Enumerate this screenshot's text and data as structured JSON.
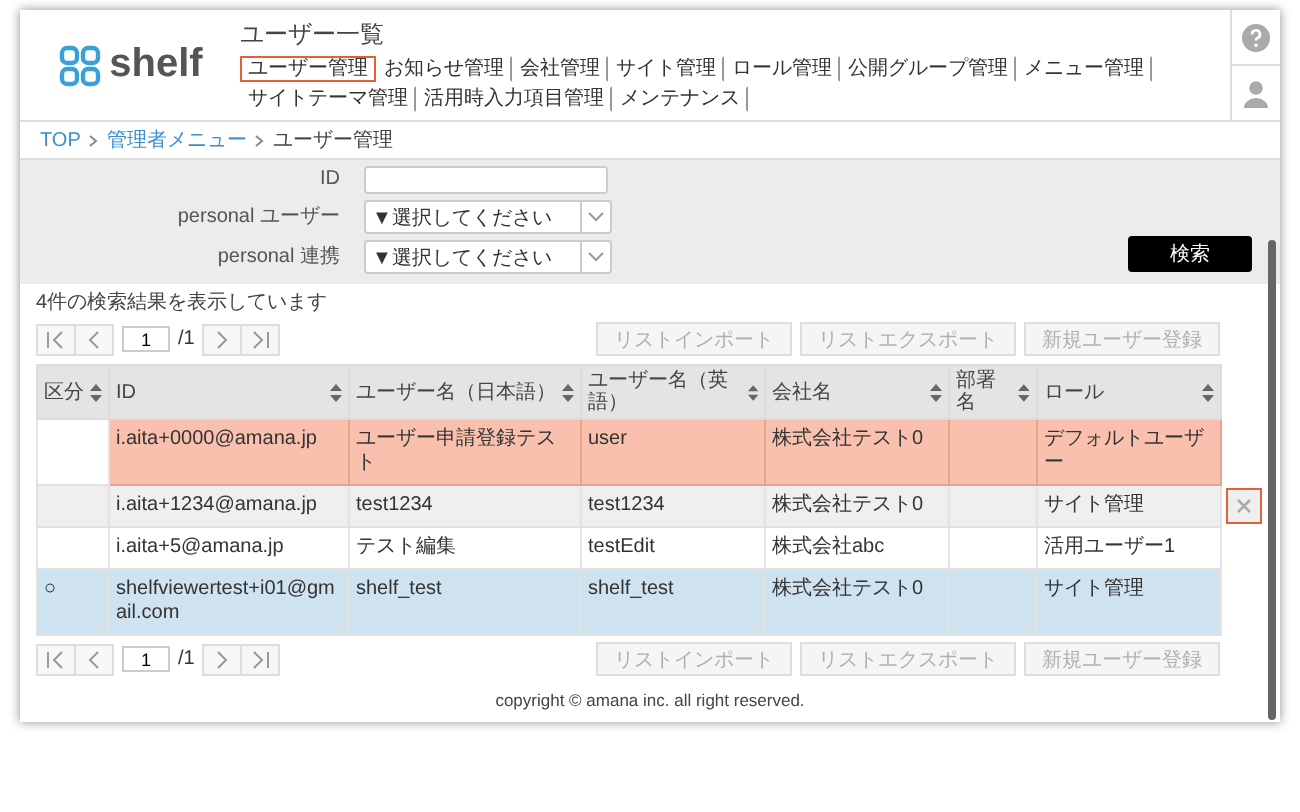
{
  "header": {
    "logo_text": "shelf",
    "title": "ユーザー一覧",
    "nav": [
      {
        "label": "ユーザー管理",
        "selected": true
      },
      {
        "label": "お知らせ管理",
        "selected": false
      },
      {
        "label": "会社管理",
        "selected": false
      },
      {
        "label": "サイト管理",
        "selected": false
      },
      {
        "label": "ロール管理",
        "selected": false
      },
      {
        "label": "公開グループ管理",
        "selected": false
      },
      {
        "label": "メニュー管理",
        "selected": false
      },
      {
        "label": "サイトテーマ管理",
        "selected": false
      },
      {
        "label": "活用時入力項目管理",
        "selected": false
      },
      {
        "label": "メンテナンス",
        "selected": false
      }
    ]
  },
  "breadcrumb": [
    {
      "label": "TOP",
      "link": true
    },
    {
      "label": "管理者メニュー",
      "link": true
    },
    {
      "label": "ユーザー管理",
      "link": false
    }
  ],
  "search": {
    "fields": [
      {
        "label": "ID",
        "kind": "text"
      },
      {
        "label": "personal ユーザー",
        "kind": "select",
        "value": "▼選択してください"
      },
      {
        "label": "personal 連携",
        "kind": "select",
        "value": "▼選択してください"
      }
    ],
    "button": "検索"
  },
  "result_message": "4件の検索結果を表示しています",
  "pager_top": {
    "page": "1",
    "total": "/1",
    "buttons": [
      {
        "label": "リストインポート",
        "disabled": true
      },
      {
        "label": "リストエクスポート",
        "disabled": true
      },
      {
        "label": "新規ユーザー登録",
        "disabled": true
      }
    ]
  },
  "table": {
    "columns": [
      {
        "label": "区分",
        "kind": "marker"
      },
      {
        "label": "ID",
        "kind": "value"
      },
      {
        "label": "ユーザー名（日本語）",
        "kind": "value"
      },
      {
        "label": "ユーザー名（英語）",
        "kind": "value"
      },
      {
        "label": "会社名",
        "kind": "value"
      },
      {
        "label": "部署名",
        "kind": "blank"
      },
      {
        "label": "ロール",
        "kind": "value"
      }
    ],
    "rows": [
      {
        "cells": [
          "",
          "i.aita+0000@amana.jp",
          "ユーザー申請登録テスト",
          "user",
          "株式会社テスト0",
          "",
          "デフォルトユーザー"
        ],
        "highlighted": true,
        "hovered": false,
        "selected": false
      },
      {
        "cells": [
          "",
          "i.aita+1234@amana.jp",
          "test1234",
          "test1234",
          "株式会社テスト0",
          "",
          "サイト管理"
        ],
        "highlighted": false,
        "hovered": true,
        "selected": false
      },
      {
        "cells": [
          "",
          "i.aita+5@amana.jp",
          "テスト編集",
          "testEdit",
          "株式会社abc",
          "",
          "活用ユーザー1"
        ],
        "highlighted": false,
        "hovered": false,
        "selected": false
      },
      {
        "cells": [
          "○",
          "shelfviewertest+i01@gmail.com",
          "shelf_test",
          "shelf_test",
          "株式会社テスト0",
          "",
          "サイト管理"
        ],
        "highlighted": false,
        "hovered": false,
        "selected": true
      }
    ]
  },
  "pager_bottom": {
    "page": "1",
    "total": "/1",
    "buttons": [
      {
        "label": "リストインポート",
        "disabled": true
      },
      {
        "label": "リストエクスポート",
        "disabled": true
      },
      {
        "label": "新規ユーザー登録",
        "disabled": true
      }
    ]
  },
  "footer": "copyright © amana inc. all right reserved."
}
